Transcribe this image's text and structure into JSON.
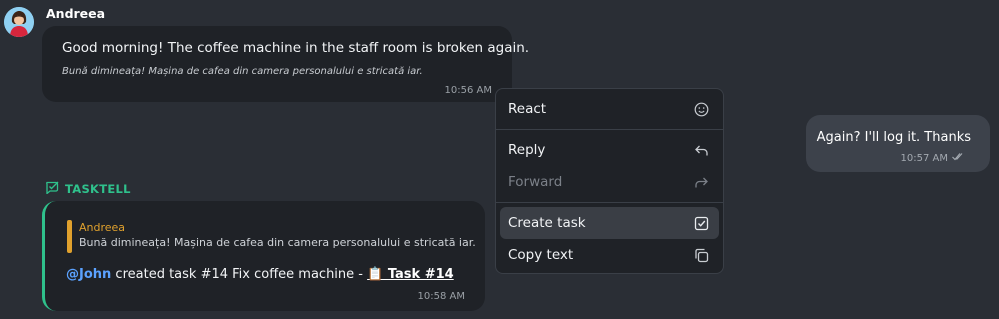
{
  "incoming": {
    "sender": "Andreea",
    "text": "Good morning! The coffee machine in the staff room is broken again.",
    "translation": "Bună dimineața! Mașina de cafea din camera personalului e stricată iar.",
    "time": "10:56 AM"
  },
  "outgoing": {
    "text": "Again? I'll log it. Thanks",
    "time": "10:57 AM",
    "status_icon": "double-check-icon"
  },
  "bot": {
    "name": "TASKTELL",
    "quote_author": "Andreea",
    "quote_text": "Bună dimineața! Mașina de cafea din camera personalului e stricată iar.",
    "mention": "@John",
    "action_text": "created task #14 Fix coffee machine -",
    "task_link": "📋 Task #14",
    "time": "10:58 AM"
  },
  "context_menu": {
    "items": [
      {
        "label": "React",
        "icon": "smile-icon",
        "enabled": true
      },
      {
        "label": "Reply",
        "icon": "reply-icon",
        "enabled": true
      },
      {
        "label": "Forward",
        "icon": "forward-icon",
        "enabled": false
      },
      {
        "label": "Create task",
        "icon": "checkbox-icon",
        "enabled": true,
        "highlighted": true
      },
      {
        "label": "Copy text",
        "icon": "copy-icon",
        "enabled": true
      }
    ]
  },
  "colors": {
    "background": "#2a2e35",
    "bubble": "#1f2227",
    "outgoing_bubble": "#3d424b",
    "bot_accent": "#2fc18c",
    "quote_accent": "#e0a12d",
    "mention": "#5ba2ff"
  }
}
